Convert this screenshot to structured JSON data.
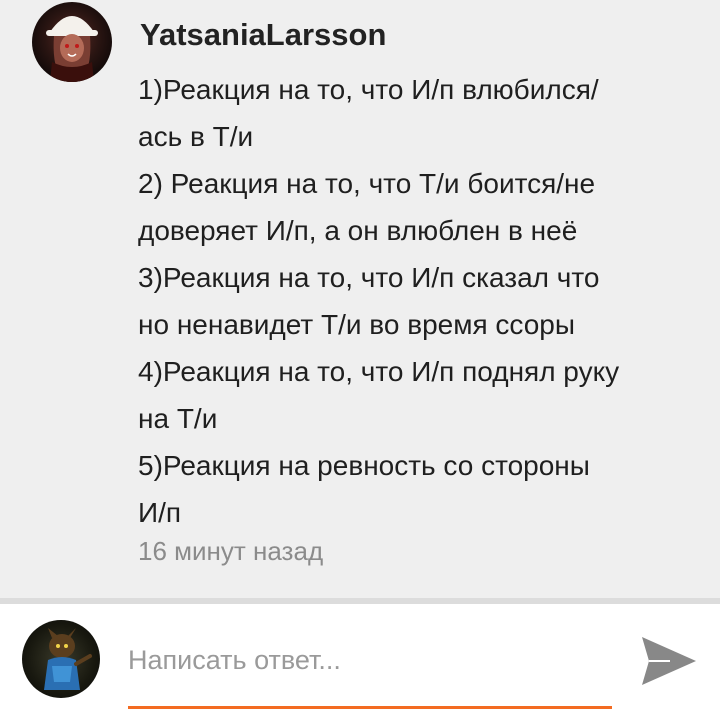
{
  "comment": {
    "author": "YatsaniaLarsson",
    "lines": [
      "1)Реакция на то, что И/п влюбился/",
      "ась в Т/и",
      "2) Реакция на то, что Т/и боится/не",
      "доверяет И/п, а он влюблен в неё",
      "3)Реакция на то, что И/п сказал что",
      "но ненавидет Т/и во время ссоры",
      "4)Реакция на то, что И/п поднял руку",
      "на Т/и",
      "5)Реакция на ревность со стороны",
      "И/п"
    ],
    "time": "16 минут назад"
  },
  "reply": {
    "placeholder": "Написать ответ...",
    "accent_color": "#f36b21",
    "send_icon": "send-icon"
  }
}
